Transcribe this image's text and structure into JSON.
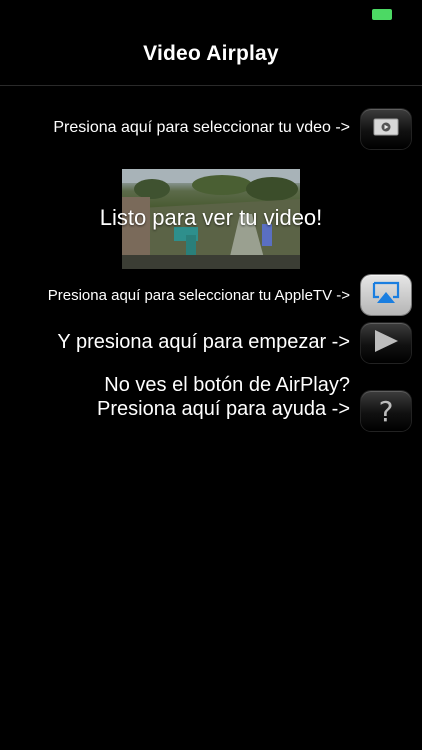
{
  "nav": {
    "title": "Video Airplay"
  },
  "rows": {
    "select_video": "Presiona aquí para seleccionar tu vdeo ->",
    "select_appletv": "Presiona aquí para seleccionar tu AppleTV ->",
    "start": "Y presiona aquí para empezar ->",
    "help_line1": "No ves el botón de AirPlay?",
    "help_line2": "Presiona aquí para ayuda ->",
    "help_symbol": "?"
  },
  "preview": {
    "caption": "Listo para ver tu video!"
  },
  "colors": {
    "battery": "#4cd964",
    "airplay_blue": "#1a7ee0",
    "background": "#000000"
  },
  "icons": [
    "battery-icon",
    "video-file-icon",
    "airplay-icon",
    "play-icon",
    "help-icon"
  ]
}
